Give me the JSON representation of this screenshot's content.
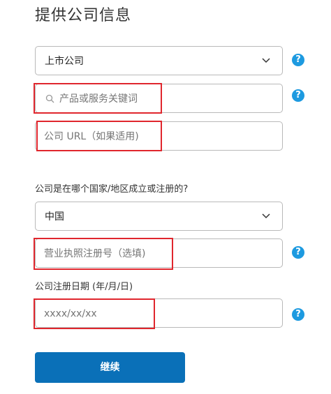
{
  "page": {
    "title": "提供公司信息"
  },
  "company_type": {
    "value": "上市公司"
  },
  "keyword_search": {
    "placeholder": "产品或服务关键词"
  },
  "company_url": {
    "placeholder": "公司 URL（如果适用)"
  },
  "country_question": {
    "label": "公司是在哪个国家/地区成立或注册的?"
  },
  "country": {
    "value": "中国"
  },
  "business_license": {
    "placeholder": "营业执照注册号（选填)"
  },
  "registration_date": {
    "label": "公司注册日期 (年/月/日)",
    "placeholder": "xxxx/xx/xx"
  },
  "help_icon_glyph": "?",
  "continue_button": {
    "label": "继续"
  },
  "colors": {
    "accent": "#0a70b8",
    "help": "#1d9ae0",
    "highlight": "#e0262d",
    "border": "#b9b9b9"
  },
  "icons": [
    "chevron-down-icon",
    "search-icon",
    "help-icon"
  ]
}
